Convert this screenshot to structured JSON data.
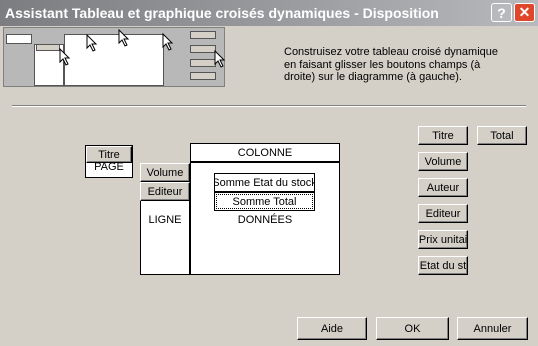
{
  "window": {
    "title": "Assistant Tableau et graphique croisés dynamiques - Disposition",
    "help_glyph": "?",
    "close_glyph": "✕"
  },
  "instructions": "Construisez votre tableau croisé dynamique en faisant glisser les boutons champs (à droite) sur le diagramme (à gauche).",
  "layout": {
    "page_label": "PAGE",
    "column_label": "COLONNE",
    "row_label": "LIGNE",
    "data_label": "DONNÉES",
    "page_fields": [
      "Titre"
    ],
    "row_fields": [
      "Volume",
      "Editeur"
    ],
    "data_fields": [
      "Somme Etat du stock",
      "Somme Total"
    ]
  },
  "available_fields": [
    "Titre",
    "Total",
    "Volume",
    "Auteur",
    "Editeur",
    "Prix unitai",
    "Etat du st"
  ],
  "buttons": {
    "help": "Aide",
    "ok": "OK",
    "cancel": "Annuler"
  },
  "colors": {
    "dialog_bg": "#d4d0c8",
    "titlebar_start": "#7b7d80",
    "close_red": "#e0462a"
  }
}
